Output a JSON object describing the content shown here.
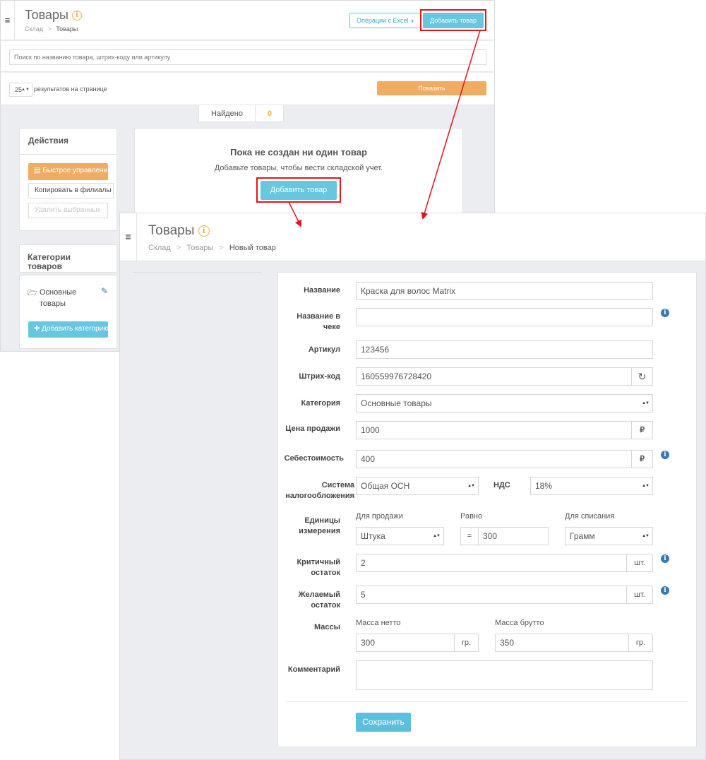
{
  "colors": {
    "accent_cyan": "#67c6e0",
    "accent_orange": "#f0ad62",
    "highlight_red": "#e3141a",
    "info_blue": "#337ab7"
  },
  "list_page": {
    "title": "Товары",
    "breadcrumb": [
      "Склад",
      "Товары"
    ],
    "excel_button": "Операции с Excel",
    "add_button": "Добавить товар",
    "search_placeholder": "Поиск по названию товара, штрих-коду или артикулу",
    "per_page_value": "25",
    "per_page_label": "результатов на странице",
    "show_button": "Показать",
    "found_label": "Найдено",
    "found_count": "0",
    "actions": {
      "title": "Действия",
      "quick_manage": "Быстрое управлени",
      "copy_to_branches": "Копировать в филиалы",
      "delete_selected": "Удалить выбранных"
    },
    "categories": {
      "title": "Категории товаров",
      "item": "Основные товары",
      "add_button": "Добавить категорию"
    },
    "empty_state": {
      "heading": "Пока не создан ни один товар",
      "text": "Добавьте товары, чтобы вести складской учет.",
      "button": "Добавить товар"
    }
  },
  "new_item_page": {
    "title": "Товары",
    "breadcrumb": [
      "Склад",
      "Товары",
      "Новый товар"
    ],
    "form": {
      "name_label": "Название",
      "name_value": "Краска для волос Matrix",
      "receipt_name_label": "Название в чеке",
      "receipt_name_value": "",
      "sku_label": "Артикул",
      "sku_value": "123456",
      "barcode_label": "Штрих-код",
      "barcode_value": "160559976728420",
      "category_label": "Категория",
      "category_value": "Основные товары",
      "price_label": "Цена продажи",
      "price_value": "1000",
      "cost_label": "Себестоимость",
      "cost_value": "400",
      "currency": "₽",
      "tax_label": "Система налогообложения",
      "tax_value": "Общая ОСН",
      "vat_label": "НДС",
      "vat_value": "18%",
      "units_label": "Единицы измерения",
      "units_sale_label": "Для продажи",
      "units_sale_value": "Штука",
      "units_equal_label": "Равно",
      "units_equal_sign": "=",
      "units_equal_value": "300",
      "units_writeoff_label": "Для списания",
      "units_writeoff_value": "Грамм",
      "critical_label": "Критичный остаток",
      "critical_value": "2",
      "desired_label": "Желаемый остаток",
      "desired_value": "5",
      "pcs": "шт.",
      "mass_label": "Массы",
      "net_label": "Масса нетто",
      "net_value": "300",
      "gross_label": "Масса брутто",
      "gross_value": "350",
      "grams": "гр.",
      "comment_label": "Комментарий",
      "comment_value": "",
      "save_button": "Сохранить"
    }
  }
}
